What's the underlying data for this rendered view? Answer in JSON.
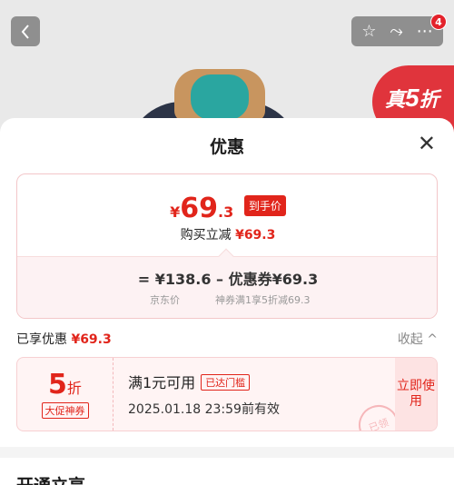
{
  "background": {
    "badge_big": "5",
    "badge_prefix": "真",
    "badge_suffix": "折",
    "notification_count": "4"
  },
  "sheet": {
    "title": "优惠",
    "price_summary": {
      "currency": "¥",
      "price_int": "69",
      "price_dec": ".3",
      "price_tag": "到手价",
      "reduce_label": "购买立减",
      "reduce_value": "¥69.3",
      "calc_line": "= ¥138.6 – 优惠券¥69.3",
      "calc_sub_left": "京东价",
      "calc_sub_right": "神券满1享5折减69.3"
    },
    "enjoyed_label": "已享优惠",
    "enjoyed_value": "¥69.3",
    "fold_label": "收起 ^",
    "coupon": {
      "discount_num": "5",
      "discount_unit": "折",
      "type_tag": "大促神券",
      "condition": "满1元可用",
      "reached_tag": "已达门槛",
      "expiry": "2025.01.18 23:59前有效",
      "use_button": "立即使用",
      "stamp": "已领"
    },
    "next_section_title": "开通立享"
  },
  "colors": {
    "accent": "#e1251b",
    "card_border": "#f3c7c9",
    "card_bg": "#fdf2f3"
  }
}
